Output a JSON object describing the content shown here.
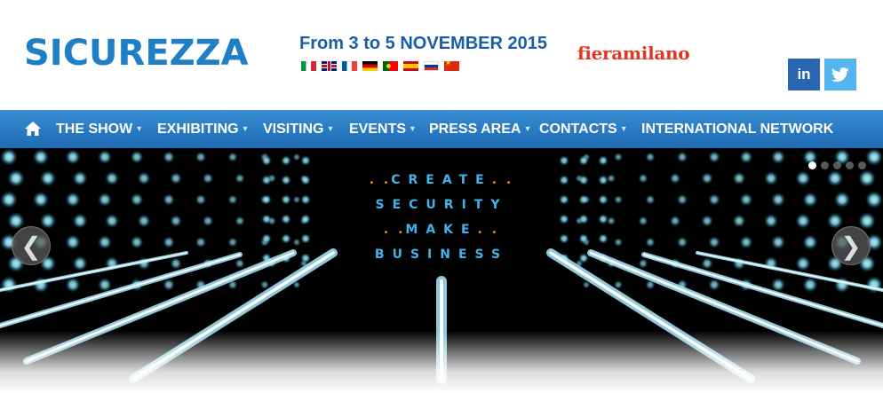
{
  "header": {
    "logo_text": "SICUREZZA",
    "dates": "From 3 to 5 NOVEMBER 2015",
    "partner_logo": "fieramilano",
    "languages": [
      {
        "code": "it",
        "icon": "italy-flag-icon"
      },
      {
        "code": "en",
        "icon": "uk-flag-icon"
      },
      {
        "code": "fr",
        "icon": "france-flag-icon"
      },
      {
        "code": "de",
        "icon": "germany-flag-icon"
      },
      {
        "code": "pt",
        "icon": "portugal-flag-icon"
      },
      {
        "code": "es",
        "icon": "spain-flag-icon"
      },
      {
        "code": "ru",
        "icon": "russia-flag-icon"
      },
      {
        "code": "zh",
        "icon": "china-flag-icon"
      }
    ],
    "social": {
      "linkedin_label": "in",
      "twitter_icon": "twitter-bird-icon"
    }
  },
  "nav": {
    "home_icon": "home-icon",
    "items": [
      {
        "label": "THE SHOW",
        "dropdown": true
      },
      {
        "label": "EXHIBITING",
        "dropdown": true
      },
      {
        "label": "VISITING",
        "dropdown": true
      },
      {
        "label": "EVENTS",
        "dropdown": true
      },
      {
        "label": "PRESS AREA",
        "dropdown": true
      },
      {
        "label": "CONTACTS",
        "dropdown": true
      },
      {
        "label": "INTERNATIONAL NETWORK",
        "dropdown": false
      }
    ]
  },
  "banner": {
    "lines": [
      "CREATE",
      "SECURITY",
      "MAKE",
      "BUSINESS"
    ],
    "prev_label": "❮",
    "next_label": "❯",
    "slides": 5,
    "active_slide": 1
  },
  "colors": {
    "brand_blue": "#1e7fc6",
    "nav_blue": "#2a7bc4",
    "accent_orange": "#f29400",
    "fiera_red": "#e4351f",
    "banner_cyan": "#3fb4ea"
  }
}
